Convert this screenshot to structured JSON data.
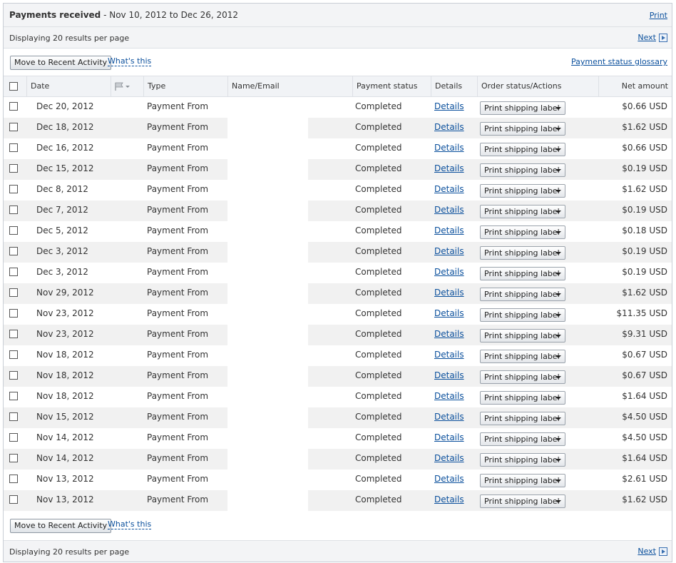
{
  "header": {
    "title_bold": "Payments received",
    "title_range": "- Nov 10, 2012 to Dec 26, 2012",
    "print_label": "Print"
  },
  "pager": {
    "text": "Displaying 20 results per page",
    "next_label": "Next"
  },
  "actions": {
    "move_button": "Move to Recent Activity",
    "whats_this": "What's this",
    "glossary": "Payment status glossary"
  },
  "columns": {
    "date": "Date",
    "type": "Type",
    "name": "Name/Email",
    "status": "Payment status",
    "details": "Details",
    "order": "Order status/Actions",
    "amount": "Net amount"
  },
  "rows": [
    {
      "date": "Dec 20, 2012",
      "type": "Payment From",
      "status": "Completed",
      "details": "Details",
      "action": "Print shipping label",
      "amount": "$0.66 USD"
    },
    {
      "date": "Dec 18, 2012",
      "type": "Payment From",
      "status": "Completed",
      "details": "Details",
      "action": "Print shipping label",
      "amount": "$1.62 USD"
    },
    {
      "date": "Dec 16, 2012",
      "type": "Payment From",
      "status": "Completed",
      "details": "Details",
      "action": "Print shipping label",
      "amount": "$0.66 USD"
    },
    {
      "date": "Dec 15, 2012",
      "type": "Payment From",
      "status": "Completed",
      "details": "Details",
      "action": "Print shipping label",
      "amount": "$0.19 USD"
    },
    {
      "date": "Dec 8, 2012",
      "type": "Payment From",
      "status": "Completed",
      "details": "Details",
      "action": "Print shipping label",
      "amount": "$1.62 USD"
    },
    {
      "date": "Dec 7, 2012",
      "type": "Payment From",
      "status": "Completed",
      "details": "Details",
      "action": "Print shipping label",
      "amount": "$0.19 USD"
    },
    {
      "date": "Dec 5, 2012",
      "type": "Payment From",
      "status": "Completed",
      "details": "Details",
      "action": "Print shipping label",
      "amount": "$0.18 USD"
    },
    {
      "date": "Dec 3, 2012",
      "type": "Payment From",
      "status": "Completed",
      "details": "Details",
      "action": "Print shipping label",
      "amount": "$0.19 USD"
    },
    {
      "date": "Dec 3, 2012",
      "type": "Payment From",
      "status": "Completed",
      "details": "Details",
      "action": "Print shipping label",
      "amount": "$0.19 USD"
    },
    {
      "date": "Nov 29, 2012",
      "type": "Payment From",
      "status": "Completed",
      "details": "Details",
      "action": "Print shipping label",
      "amount": "$1.62 USD"
    },
    {
      "date": "Nov 23, 2012",
      "type": "Payment From",
      "status": "Completed",
      "details": "Details",
      "action": "Print shipping label",
      "amount": "$11.35 USD"
    },
    {
      "date": "Nov 23, 2012",
      "type": "Payment From",
      "status": "Completed",
      "details": "Details",
      "action": "Print shipping label",
      "amount": "$9.31 USD"
    },
    {
      "date": "Nov 18, 2012",
      "type": "Payment From",
      "status": "Completed",
      "details": "Details",
      "action": "Print shipping label",
      "amount": "$0.67 USD"
    },
    {
      "date": "Nov 18, 2012",
      "type": "Payment From",
      "status": "Completed",
      "details": "Details",
      "action": "Print shipping label",
      "amount": "$0.67 USD"
    },
    {
      "date": "Nov 18, 2012",
      "type": "Payment From",
      "status": "Completed",
      "details": "Details",
      "action": "Print shipping label",
      "amount": "$1.64 USD"
    },
    {
      "date": "Nov 15, 2012",
      "type": "Payment From",
      "status": "Completed",
      "details": "Details",
      "action": "Print shipping label",
      "amount": "$4.50 USD"
    },
    {
      "date": "Nov 14, 2012",
      "type": "Payment From",
      "status": "Completed",
      "details": "Details",
      "action": "Print shipping label",
      "amount": "$4.50 USD"
    },
    {
      "date": "Nov 14, 2012",
      "type": "Payment From",
      "status": "Completed",
      "details": "Details",
      "action": "Print shipping label",
      "amount": "$1.64 USD"
    },
    {
      "date": "Nov 13, 2012",
      "type": "Payment From",
      "status": "Completed",
      "details": "Details",
      "action": "Print shipping label",
      "amount": "$2.61 USD"
    },
    {
      "date": "Nov 13, 2012",
      "type": "Payment From",
      "status": "Completed",
      "details": "Details",
      "action": "Print shipping label",
      "amount": "$1.62 USD"
    }
  ]
}
